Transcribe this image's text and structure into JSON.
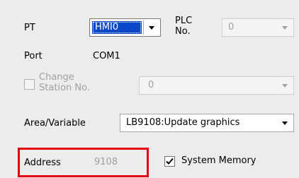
{
  "pt": {
    "label": "PT",
    "selected": "HMI0"
  },
  "plc": {
    "label_line1": "PLC",
    "label_line2": "No.",
    "value": "0"
  },
  "port": {
    "label": "Port",
    "value": "COM1"
  },
  "change_station": {
    "label_line1": "Change",
    "label_line2": "Station No.",
    "checked": false,
    "value": "0"
  },
  "area_variable": {
    "label": "Area/Variable",
    "selected": "LB9108:Update graphics"
  },
  "address": {
    "label": "Address",
    "value": "9108"
  },
  "system_memory": {
    "label": "System Memory",
    "checked": true
  },
  "colors": {
    "selection_bg": "#0a48c9",
    "highlight_border": "#e60012"
  },
  "icons": [
    "chevron-down-icon",
    "checkmark-icon"
  ]
}
